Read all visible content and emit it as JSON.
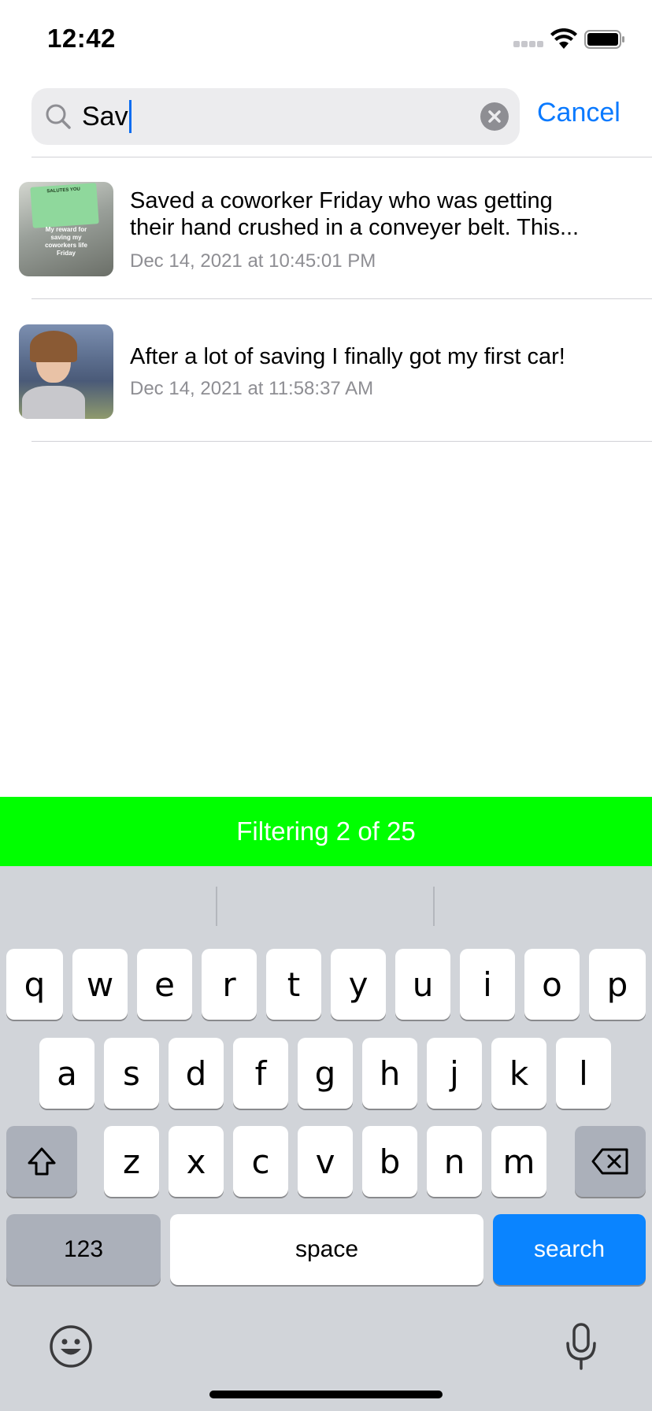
{
  "status_bar": {
    "time": "12:42"
  },
  "search": {
    "value": "Sav",
    "cancel_label": "Cancel"
  },
  "results": [
    {
      "title_line1": "Saved a coworker Friday who was getting",
      "title_line2": "their hand crushed in a conveyer belt. This...",
      "date": "Dec 14, 2021 at 10:45:01 PM",
      "thumbnail_text": [
        "SALUTES YOU",
        "My reward for",
        "saving my",
        "coworkers life",
        "Friday"
      ]
    },
    {
      "title": "After a lot of saving I finally got my first car!",
      "date": "Dec 14, 2021 at 11:58:37 AM"
    }
  ],
  "filter_banner": {
    "text": "Filtering 2 of 25",
    "color": "#00ff00"
  },
  "keyboard": {
    "row1": [
      "q",
      "w",
      "e",
      "r",
      "t",
      "y",
      "u",
      "i",
      "o",
      "p"
    ],
    "row2": [
      "a",
      "s",
      "d",
      "f",
      "g",
      "h",
      "j",
      "k",
      "l"
    ],
    "row3": [
      "z",
      "x",
      "c",
      "v",
      "b",
      "n",
      "m"
    ],
    "numbers_label": "123",
    "space_label": "space",
    "search_label": "search",
    "accent": "#0a84ff"
  }
}
